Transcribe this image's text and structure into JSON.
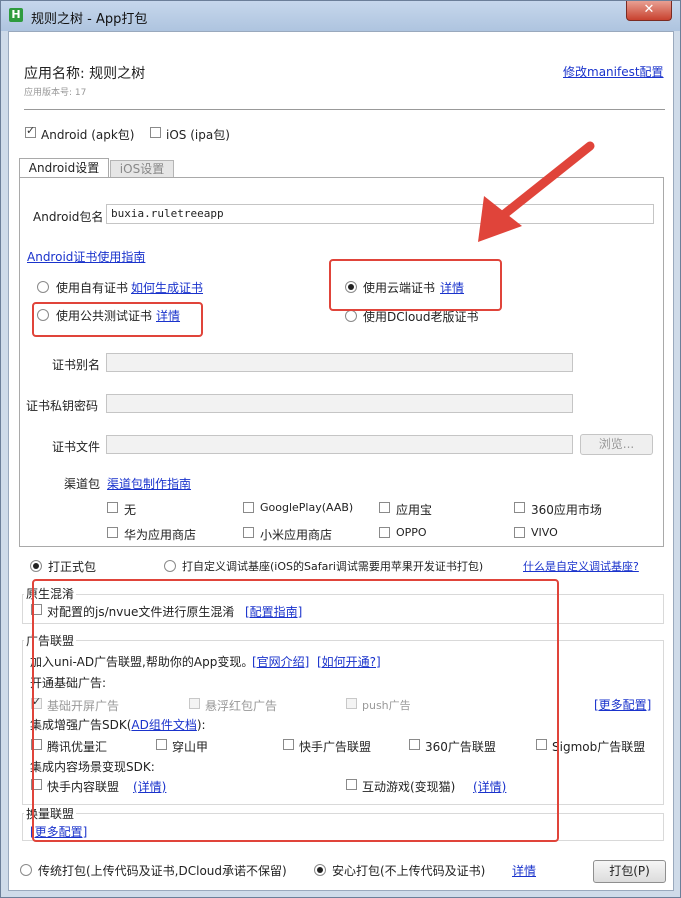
{
  "window": {
    "title": "规则之树 - App打包",
    "icon_letter": "H",
    "close_glyph": "✕"
  },
  "header": {
    "app_name_label": "应用名称: 规则之树",
    "version_label": "应用版本号: 17",
    "edit_manifest_link": "修改manifest配置"
  },
  "platforms": {
    "android": {
      "label": "Android (apk包)",
      "checked": true
    },
    "ios": {
      "label": "iOS (ipa包)",
      "checked": false
    }
  },
  "tabs": [
    {
      "label": "Android设置",
      "active": true
    },
    {
      "label": "iOS设置",
      "active": false
    }
  ],
  "android": {
    "package_label": "Android包名",
    "package_value": "buxia.ruletreeapp",
    "cert_guide_link": "Android证书使用指南",
    "cert_options": {
      "own": {
        "label": "使用自有证书",
        "link": "如何生成证书",
        "checked": false
      },
      "cloud": {
        "label": "使用云端证书",
        "link": "详情",
        "checked": true
      },
      "public_test": {
        "label": "使用公共测试证书",
        "link": "详情",
        "checked": false
      },
      "dcloud_old": {
        "label": "使用DCloud老版证书",
        "checked": false
      }
    },
    "alias_label": "证书别名",
    "password_label": "证书私钥密码",
    "file_label": "证书文件",
    "browse_button": "浏览...",
    "channel_label": "渠道包",
    "channel_link": "渠道包制作指南",
    "channels": [
      "无",
      "GooglePlay(AAB)",
      "应用宝",
      "360应用市场",
      "华为应用商店",
      "小米应用商店",
      "OPPO",
      "VIVO"
    ]
  },
  "build_mode": {
    "formal": {
      "label": "打正式包",
      "checked": true
    },
    "custom": {
      "label": "打自定义调试基座(iOS的Safari调试需要用苹果开发证书打包)",
      "checked": false
    },
    "custom_link": "什么是自定义调试基座?"
  },
  "native_obfuscation": {
    "title": "原生混淆",
    "option_label": "对配置的js/nvue文件进行原生混淆",
    "link": "[配置指南]"
  },
  "ad_alliance": {
    "title": "广告联盟",
    "intro_text": "加入uni-AD广告联盟,帮助你的App变现。",
    "intro_link1": "[官网介绍]",
    "intro_link2": "[如何开通?]",
    "basic_title": "开通基础广告:",
    "basic_items": [
      {
        "label": "基础开屏广告",
        "checked": true
      },
      {
        "label": "悬浮红包广告",
        "checked": false
      },
      {
        "label": "push广告",
        "checked": false
      }
    ],
    "more_config_link": "[更多配置]",
    "enhanced_title_prefix": "集成增强广告SDK(",
    "enhanced_title_link": "AD组件文档",
    "enhanced_title_suffix": "):",
    "enhanced_items": [
      "腾讯优量汇",
      "穿山甲",
      "快手广告联盟",
      "360广告联盟",
      "Sigmob广告联盟"
    ],
    "content_title": "集成内容场景变现SDK:",
    "content_items": [
      {
        "label": "快手内容联盟",
        "link": "(详情)"
      },
      {
        "label": "互动游戏(变现猫)",
        "link": "(详情)"
      }
    ]
  },
  "exchange": {
    "title": "换量联盟",
    "link": "[更多配置]"
  },
  "footer": {
    "traditional": {
      "label": "传统打包(上传代码及证书,DCloud承诺不保留)",
      "checked": false
    },
    "safe": {
      "label": "安心打包(不上传代码及证书)",
      "checked": true
    },
    "detail_link": "详情",
    "pack_button": "打包(P)"
  },
  "colors": {
    "annotation_red": "#e0443a",
    "link_blue": "#1a33cc"
  }
}
